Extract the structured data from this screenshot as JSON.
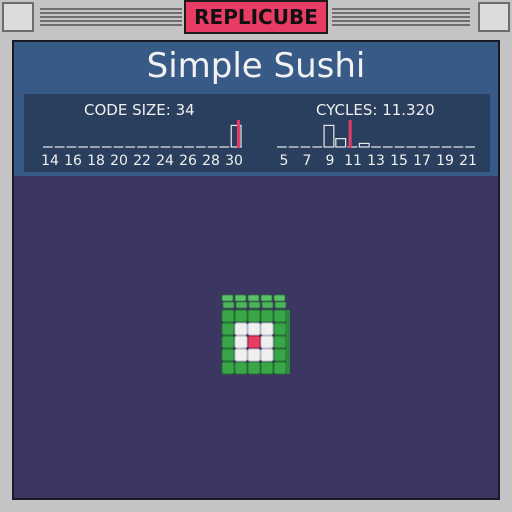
{
  "app": {
    "title": "REPLICUBE"
  },
  "puzzle": {
    "title": "Simple Sushi"
  },
  "stats": {
    "code_size": {
      "label": "CODE SIZE: 34",
      "ticks": [
        "14",
        "16",
        "18",
        "20",
        "22",
        "24",
        "26",
        "28",
        "30"
      ],
      "bars": [
        0,
        0,
        0,
        0,
        0,
        0,
        0,
        0,
        0,
        0,
        0,
        0,
        0,
        0,
        0,
        0,
        0.9
      ],
      "marker_index": 16.7
    },
    "cycles": {
      "label": "CYCLES: 11.320",
      "ticks": [
        "5",
        "7",
        "9",
        "11",
        "13",
        "15",
        "17",
        "19",
        "21"
      ],
      "bars": [
        0.05,
        0.05,
        0,
        0,
        0.9,
        0.35,
        0,
        0.15,
        0.05,
        0.05,
        0.05,
        0.05,
        0.05,
        0.05,
        0.05,
        0.05,
        0.05
      ],
      "marker_index": 6.3
    }
  },
  "colors": {
    "accent": "#e83c64",
    "header": "#385a86",
    "stats_bg": "#2a3e5e",
    "scene_bg": "#3b3662",
    "nori": "#3aa64a",
    "rice": "#f0f0f0",
    "fish": "#e83c64"
  },
  "cube": {
    "grid": 5,
    "icon": "voxel-sushi-cube"
  }
}
